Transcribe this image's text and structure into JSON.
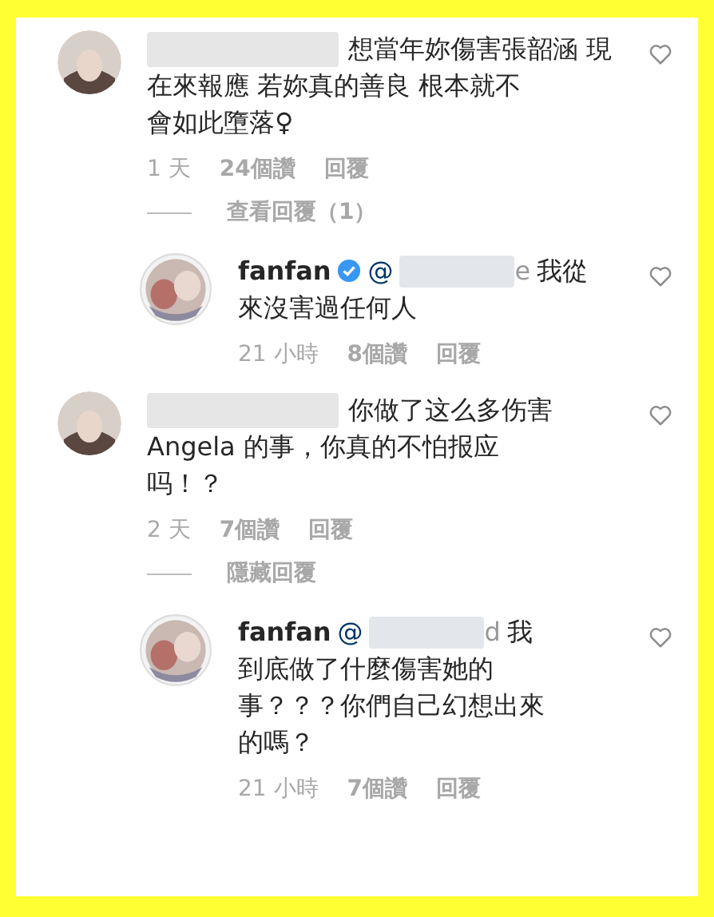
{
  "comments": [
    {
      "kind": "top",
      "text_lines": [
        "想當年妳傷害張韶涵 現",
        "在來報應 若妳真的善良 根本就不",
        "會如此墮落♀"
      ],
      "time": "1 天",
      "likes": "24個讚",
      "reply": "回覆",
      "replies_link": "查看回覆（1）"
    },
    {
      "kind": "reply",
      "username": "fanfan",
      "verified": true,
      "mention": "@",
      "mention_tail": "e",
      "text_lines": [
        "我從",
        "來沒害過任何人"
      ],
      "time": "21 小時",
      "likes": "8個讚",
      "reply": "回覆"
    },
    {
      "kind": "top",
      "text_lines": [
        "你做了这么多伤害",
        "Angela 的事，你真的不怕报应",
        "吗！？"
      ],
      "time": "2 天",
      "likes": "7個讚",
      "reply": "回覆",
      "replies_link": "隱藏回覆"
    },
    {
      "kind": "reply",
      "username": "fanfan",
      "verified": false,
      "mention": "@",
      "mention_tail": "d",
      "text_lines": [
        "我",
        "到底做了什麼傷害她的",
        "事？？？你們自己幻想出來",
        "的嗎？"
      ],
      "time": "21 小時",
      "likes": "7個讚",
      "reply": "回覆"
    }
  ]
}
